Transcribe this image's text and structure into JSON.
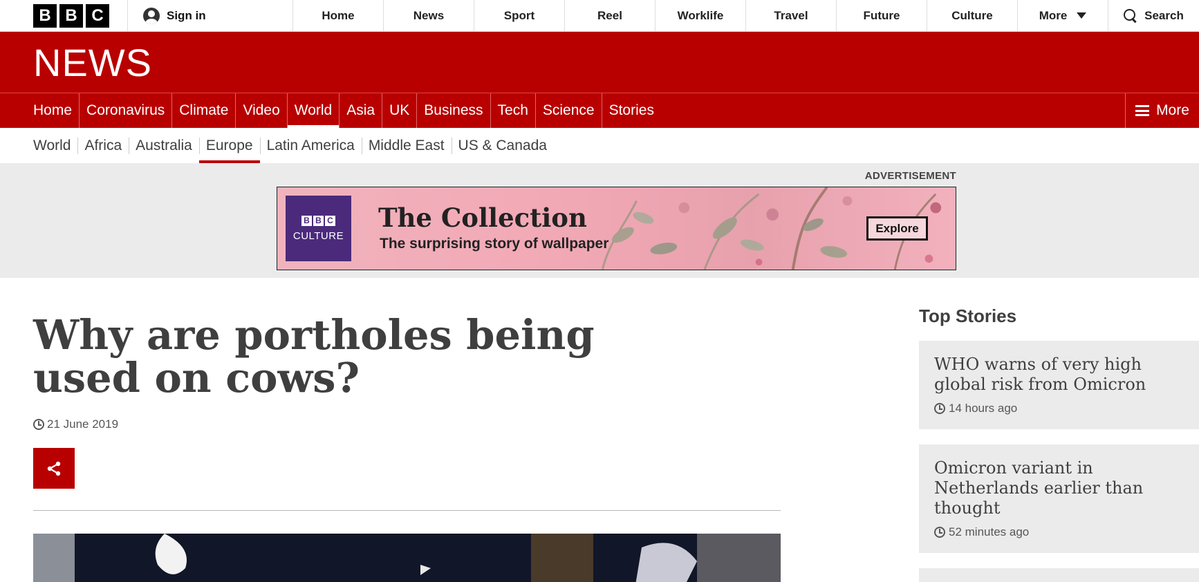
{
  "topbar": {
    "logo_letters": [
      "B",
      "B",
      "C"
    ],
    "sign_in": "Sign in",
    "nav": [
      "Home",
      "News",
      "Sport",
      "Reel",
      "Worklife",
      "Travel",
      "Future",
      "Culture"
    ],
    "more": "More",
    "search": "Search"
  },
  "brand": {
    "section_title": "NEWS",
    "color": "#b80000"
  },
  "main_nav": {
    "items": [
      "Home",
      "Coronavirus",
      "Climate",
      "Video",
      "World",
      "Asia",
      "UK",
      "Business",
      "Tech",
      "Science",
      "Stories"
    ],
    "active": "World",
    "more": "More"
  },
  "sub_nav": {
    "items": [
      "World",
      "Africa",
      "Australia",
      "Europe",
      "Latin America",
      "Middle East",
      "US & Canada"
    ],
    "active": "Europe"
  },
  "advert": {
    "label": "ADVERTISEMENT",
    "brand_letters": [
      "B",
      "B",
      "C"
    ],
    "brand_name": "CULTURE",
    "title": "The Collection",
    "subtitle": "The surprising story of wallpaper",
    "cta": "Explore"
  },
  "article": {
    "headline": "Why are portholes being used on cows?",
    "date": "21 June 2019"
  },
  "sidebar": {
    "title": "Top Stories",
    "stories": [
      {
        "title": "WHO warns of very high global risk from Omicron",
        "time": "14 hours ago"
      },
      {
        "title": "Omicron variant in Netherlands earlier than thought",
        "time": "52 minutes ago"
      }
    ]
  }
}
